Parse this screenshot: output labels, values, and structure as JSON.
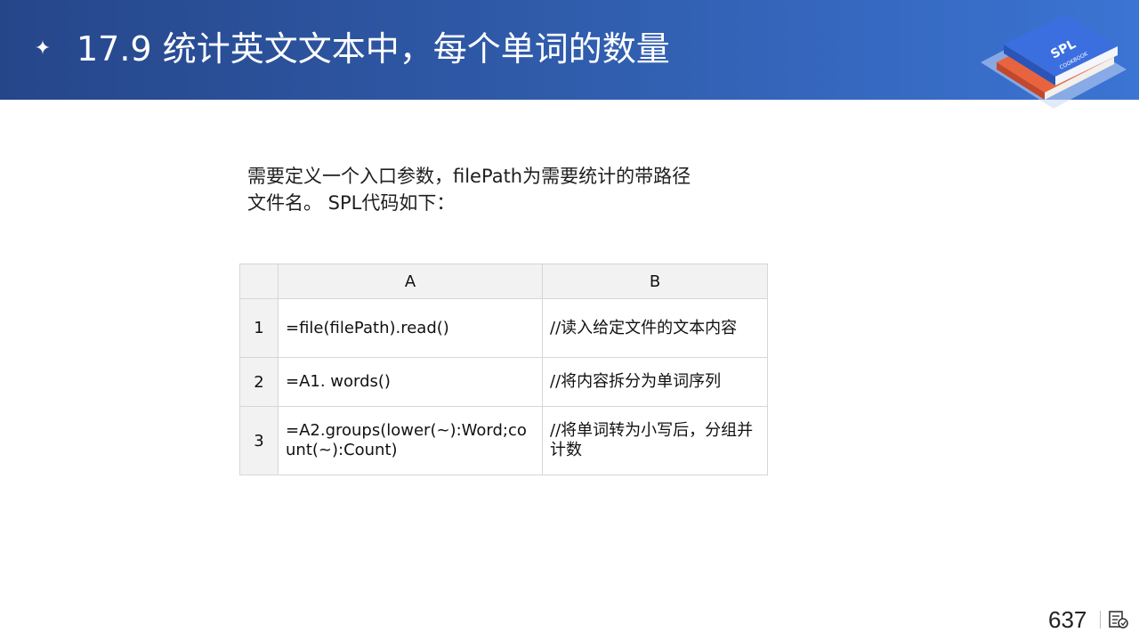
{
  "header": {
    "bullet_icon": "four-point-star-icon",
    "title": "17.9 统计英文文本中，每个单词的数量",
    "logo": {
      "icon": "spl-cookbook-book-stack-logo",
      "text_main": "SPL",
      "text_sub": "COOKBOOK",
      "colors": {
        "blue": "#3b6fe0",
        "red": "#d8553a"
      }
    }
  },
  "intro": {
    "line1": "需要定义一个入口参数，filePath为需要统计的带路径",
    "line2": "文件名。 SPL代码如下："
  },
  "table": {
    "columns": [
      "A",
      "B"
    ],
    "rows": [
      {
        "num": "1",
        "a": "=file(filePath).read()",
        "b": "//读入给定文件的文本内容"
      },
      {
        "num": "2",
        "a": "=A1. words()",
        "b": "//将内容拆分为单词序列"
      },
      {
        "num": "3",
        "a": "=A2.groups(lower(~):Word;count(~):Count)",
        "b": "//将单词转为小写后，分组并计数"
      }
    ]
  },
  "footer": {
    "page_number": "637",
    "slide_icon": "slide-notes-icon"
  },
  "colors": {
    "header_start": "#26468a",
    "header_end": "#3b74d3",
    "table_header_bg": "#f2f2f2",
    "table_border": "#d6d6d6"
  }
}
